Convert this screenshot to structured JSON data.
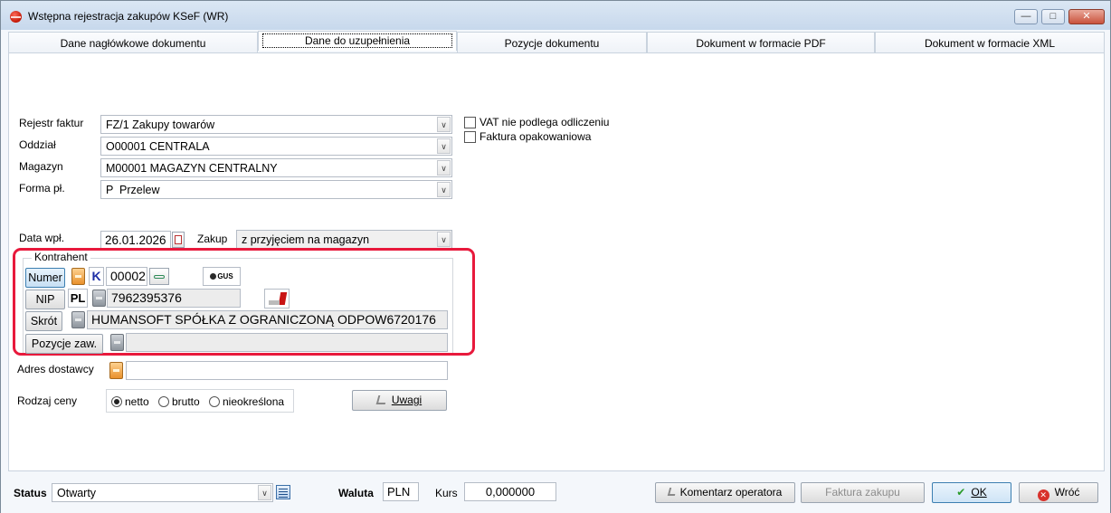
{
  "window": {
    "title": "Wstępna rejestracja zakupów KSeF (WR)"
  },
  "tabs": [
    {
      "label": "Dane nagłówkowe dokumentu"
    },
    {
      "label": "Dane do uzupełnienia"
    },
    {
      "label": "Pozycje dokumentu"
    },
    {
      "label": "Dokument w formacie PDF"
    },
    {
      "label": "Dokument w formacie XML"
    }
  ],
  "form": {
    "rejestr": {
      "label": "Rejestr faktur",
      "value": "FZ/1 Zakupy towarów"
    },
    "oddzial": {
      "label": "Oddział",
      "value": "O00001 CENTRALA"
    },
    "magazyn": {
      "label": "Magazyn",
      "value": "M00001 MAGAZYN CENTRALNY"
    },
    "forma": {
      "label": "Forma pł.",
      "value": "P  Przelew"
    },
    "vat_nie_podlega": {
      "label": "VAT nie podlega odliczeniu",
      "checked": false
    },
    "faktura_opakowaniowa": {
      "label": "Faktura opakowaniowa",
      "checked": false
    },
    "data_wpl": {
      "label": "Data wpł.",
      "value": "26.01.2026"
    },
    "zakup": {
      "label": "Zakup",
      "value": "z przyjęciem na magazyn"
    }
  },
  "kontrahent": {
    "group_label": "Kontrahent",
    "numer_button": "Numer",
    "k_label": "K",
    "numer_value": "00002",
    "gus_label": "GUS",
    "nip_button": "NIP",
    "nip_prefix": "PL",
    "nip_value": "7962395376",
    "skrot_button": "Skrót",
    "skrot_value": "HUMANSOFT SPÓŁKA Z OGRANICZONĄ ODPOW6720176",
    "pozycje_button": "Pozycje zaw.",
    "pozycje_value": ""
  },
  "adres": {
    "label": "Adres dostawcy",
    "value": ""
  },
  "rodzaj_ceny": {
    "label": "Rodzaj ceny",
    "options": [
      "netto",
      "brutto",
      "nieokreślona"
    ],
    "selected": "netto"
  },
  "uwagi_button": "Uwagi",
  "footer": {
    "status_label": "Status",
    "status_value": "Otwarty",
    "waluta_label": "Waluta",
    "waluta_value": "PLN",
    "kurs_label": "Kurs",
    "kurs_value": "0,000000",
    "komentarz_button": "Komentarz operatora",
    "faktura_button": "Faktura zakupu",
    "ok_button": "OK",
    "wroc_button": "Wróć"
  },
  "colors": {
    "highlight": "#e8193c",
    "accent": "#3c7fb1"
  }
}
